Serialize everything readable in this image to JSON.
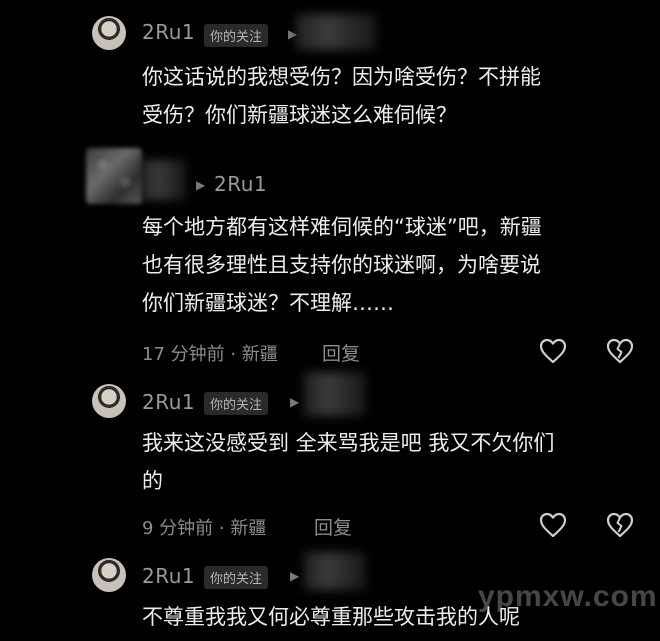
{
  "comments": [
    {
      "username": "2Ru1",
      "tag": "你的关注",
      "lines": [
        "你这话说的我想受伤？因为啥受伤？不拼能",
        "受伤？你们新疆球迷这么难伺候？"
      ]
    },
    {
      "reply_to": "2Ru1",
      "lines": [
        "每个地方都有这样难伺候的“球迷”吧，新疆",
        "也有很多理性且支持你的球迷啊，为啥要说",
        "你们新疆球迷？不理解……"
      ],
      "time": "17 分钟前 · 新疆",
      "reply_label": "回复"
    },
    {
      "username": "2Ru1",
      "tag": "你的关注",
      "lines": [
        "我来这没感受到 全来骂我是吧 我又不欠你们",
        "的"
      ],
      "time": "9 分钟前 · 新疆",
      "reply_label": "回复"
    },
    {
      "username": "2Ru1",
      "tag": "你的关注",
      "lines": [
        "不尊重我我又何必尊重那些攻击我的人呢"
      ]
    }
  ],
  "watermark": "ypmxw.com",
  "icons": {
    "like": "heart-outline-icon",
    "dislike": "broken-heart-icon"
  },
  "colors": {
    "background": "#000000",
    "text": "#ededed",
    "muted": "#8c8c8c"
  }
}
